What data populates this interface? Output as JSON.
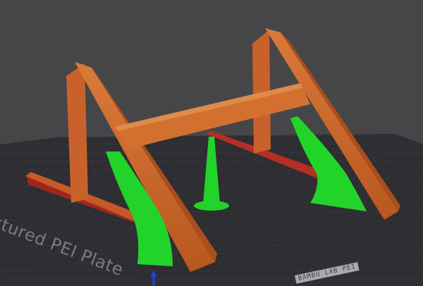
{
  "plate": {
    "label": "xtured PEI Plate",
    "brand_text": "BAMBU LAB PEI"
  },
  "colors": {
    "background": "#464649",
    "plate": "#2d2d32",
    "grid": "#3b3b41",
    "part_orange": "#d0692b",
    "part_dark": "#a94e1c",
    "base_red": "#b52f23",
    "support_green": "#22d42a",
    "axis_blue": "#2244dd"
  },
  "icons": {
    "z_axis": "up-arrow-icon"
  }
}
